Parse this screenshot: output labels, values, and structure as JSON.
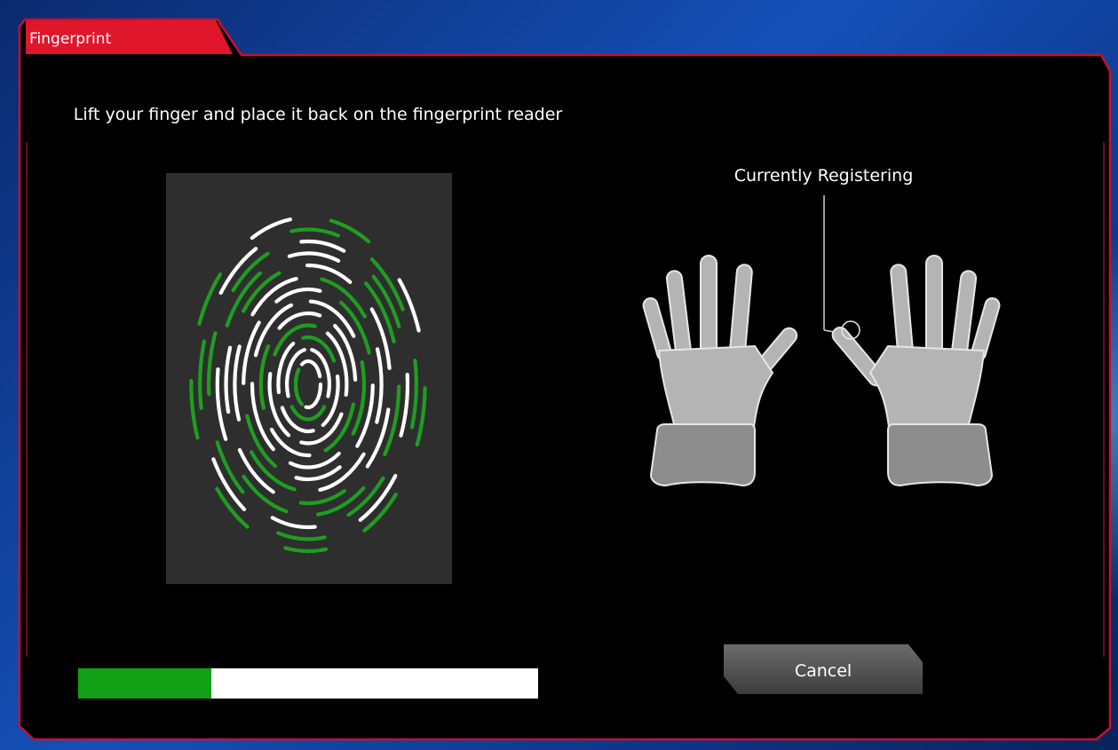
{
  "window": {
    "title": "Fingerprint"
  },
  "main": {
    "instruction": "Lift your finger and place it back on the fingerprint reader",
    "current_label": "Currently Registering",
    "selected_finger": "right-thumb",
    "progress": 0.29
  },
  "buttons": {
    "cancel_label": "Cancel"
  },
  "colors": {
    "accent": "#e0162b",
    "progress": "#12a017",
    "ridge_scanned": "#1f9d22",
    "ridge_pending": "#ffffff",
    "panel_bg": "#2e2e2e"
  }
}
